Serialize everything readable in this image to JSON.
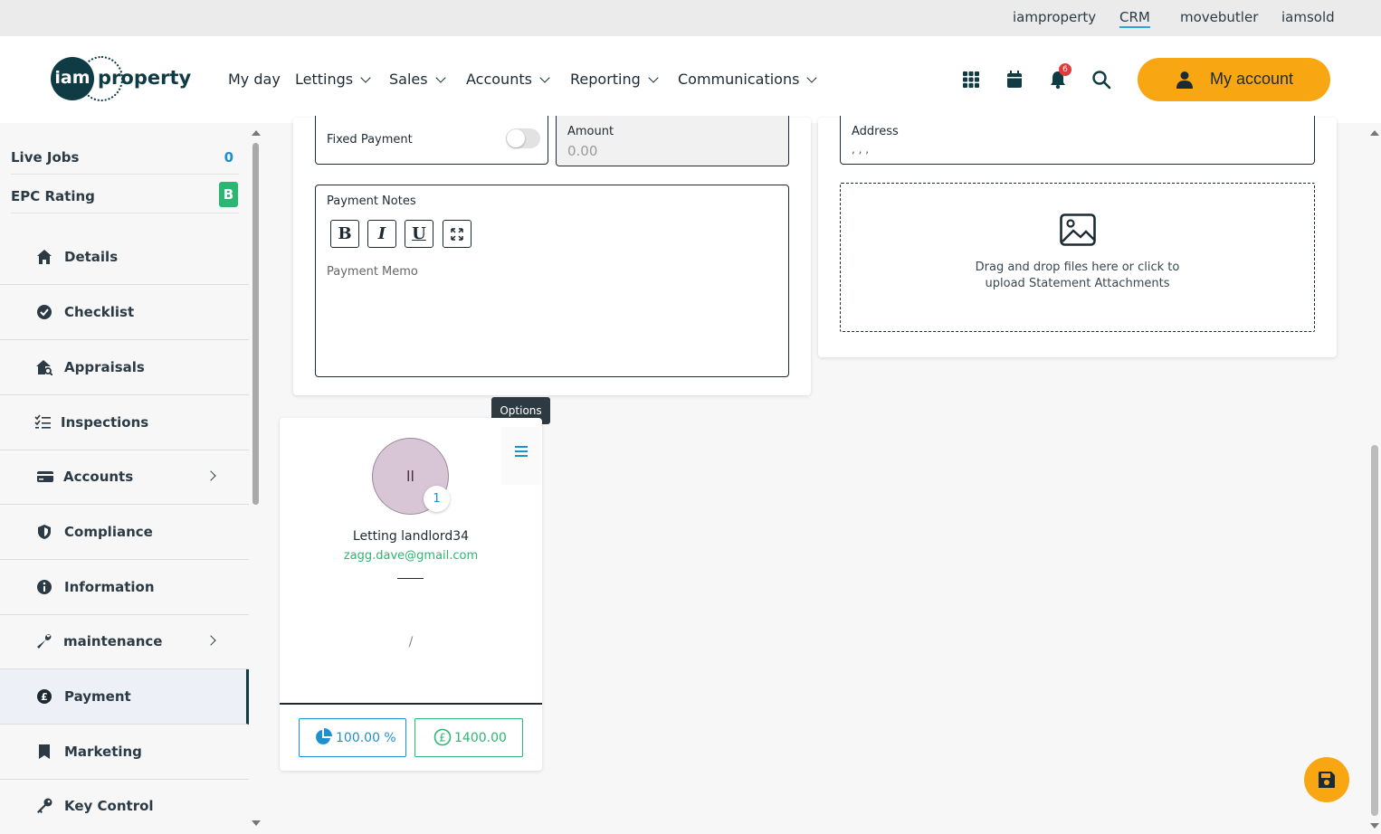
{
  "topbar": {
    "links": [
      "iamproperty",
      "CRM",
      "movebutler",
      "iamsold"
    ],
    "active": "CRM"
  },
  "brand": {
    "logo_circle_text": "iam",
    "logo_word": "property"
  },
  "nav": {
    "items": [
      {
        "label": "My day",
        "dropdown": false
      },
      {
        "label": "Lettings",
        "dropdown": true
      },
      {
        "label": "Sales",
        "dropdown": true
      },
      {
        "label": "Accounts",
        "dropdown": true
      },
      {
        "label": "Reporting",
        "dropdown": true
      },
      {
        "label": "Communications",
        "dropdown": true
      }
    ],
    "notification_count": "6",
    "account_label": "My account",
    "icons": [
      "apps-grid-icon",
      "calendar-icon",
      "bell-icon",
      "search-icon",
      "person-icon"
    ]
  },
  "sidebar": {
    "stats": [
      {
        "label": "Live Jobs",
        "value": "0"
      },
      {
        "label": "EPC Rating",
        "value": "B"
      }
    ],
    "items": [
      {
        "label": "Details",
        "icon": "home-icon",
        "arrow": false
      },
      {
        "label": "Checklist",
        "icon": "check-circle-icon",
        "arrow": false
      },
      {
        "label": "Appraisals",
        "icon": "house-search-icon",
        "arrow": false
      },
      {
        "label": "Inspections",
        "icon": "list-check-icon",
        "arrow": false
      },
      {
        "label": "Accounts",
        "icon": "credit-card-icon",
        "arrow": true
      },
      {
        "label": "Compliance",
        "icon": "shield-icon",
        "arrow": false
      },
      {
        "label": "Information",
        "icon": "info-icon",
        "arrow": false
      },
      {
        "label": "maintenance",
        "icon": "wrench-icon",
        "arrow": true
      },
      {
        "label": "Payment",
        "icon": "pound-circle-icon",
        "arrow": false,
        "active": true
      },
      {
        "label": "Marketing",
        "icon": "bookmark-icon",
        "arrow": false
      },
      {
        "label": "Key Control",
        "icon": "key-icon",
        "arrow": false
      }
    ]
  },
  "payment_form": {
    "fixed_payment_label": "Fixed Payment",
    "fixed_payment_on": false,
    "amount_label": "Amount",
    "amount_value": "0.00",
    "notes_label": "Payment Notes",
    "toolbar": [
      "B",
      "I",
      "U"
    ],
    "memo_placeholder": "Payment Memo"
  },
  "statement": {
    "address_label": "Address",
    "address_value": ", , ,",
    "dropzone_line1": "Drag and drop files here or click to",
    "dropzone_line2": "upload Statement Attachments"
  },
  "tooltip": "Options",
  "landlord": {
    "avatar_initials": "ll",
    "avatar_count": "1",
    "name": "Letting landlord34",
    "email": "zagg.dave@gmail.com",
    "slash": "/",
    "share_percent": "100.00 %",
    "amount": "1400.00"
  },
  "colors": {
    "accent": "#f8a713",
    "brand": "#0e3b44",
    "link_blue": "#1f8fd0",
    "green": "#2bb673"
  }
}
